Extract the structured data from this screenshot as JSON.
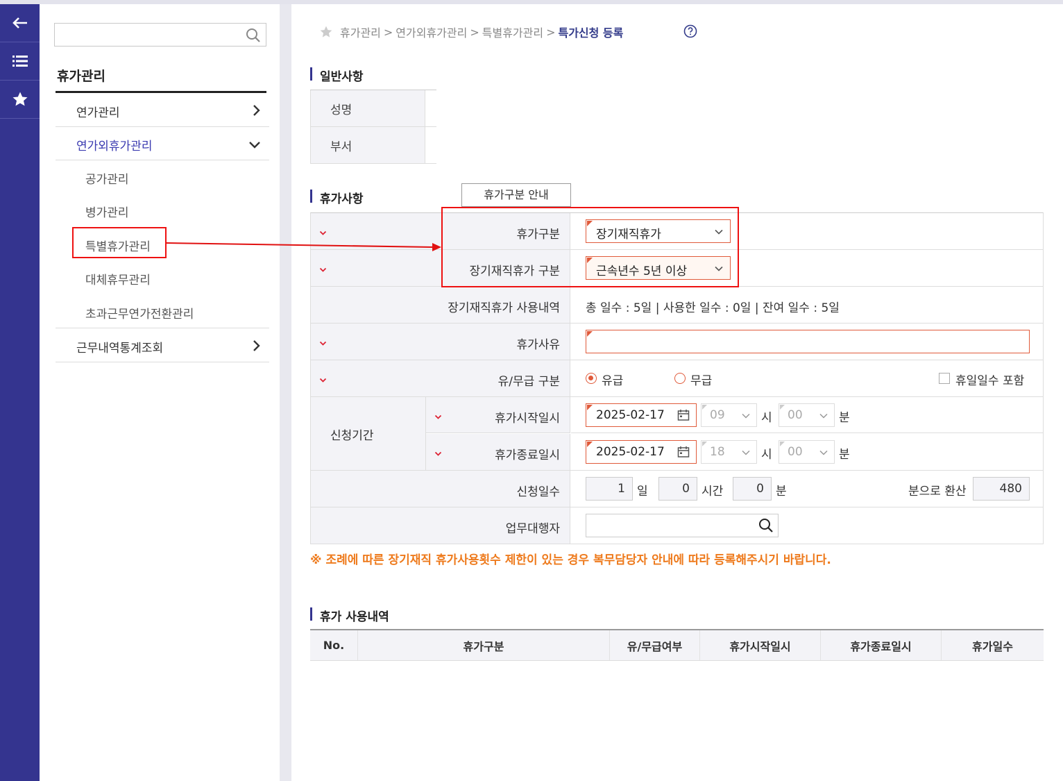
{
  "sidebar": {
    "search_placeholder": "",
    "menu_title": "휴가관리",
    "items": [
      {
        "label": "연가관리"
      },
      {
        "label": "연가외휴가관리"
      },
      {
        "label": "근무내역통계조회"
      }
    ],
    "sub_items": [
      {
        "label": "공가관리"
      },
      {
        "label": "병가관리"
      },
      {
        "label": "특별휴가관리"
      },
      {
        "label": "대체휴무관리"
      },
      {
        "label": "초과근무연가전환관리"
      }
    ]
  },
  "breadcrumb": {
    "items": [
      "휴가관리",
      "연가외휴가관리",
      "특별휴가관리"
    ],
    "separator": ">",
    "current": "특가신청 등록"
  },
  "general": {
    "title": "일반사항",
    "name_label": "성명",
    "dept_label": "부서"
  },
  "leave": {
    "title": "휴가사항",
    "guide_button": "휴가구분 안내",
    "type_label": "휴가구분",
    "type_value": "장기재직휴가",
    "subtype_label": "장기재직휴가 구분",
    "subtype_value": "근속년수 5년 이상",
    "history_label": "장기재직휴가 사용내역",
    "history_value": "총 일수 : 5일 | 사용한 일수 : 0일 | 잔여 일수 : 5일",
    "reason_label": "휴가사유",
    "reason_value": "",
    "pay_label": "유/무급 구분",
    "paid": "유급",
    "unpaid": "무급",
    "holiday_include": "휴일일수 포함",
    "period_label": "신청기간",
    "start_label": "휴가시작일시",
    "start_date": "2025-02-17",
    "start_hour": "09",
    "start_min": "00",
    "end_label": "휴가종료일시",
    "end_date": "2025-02-17",
    "end_hour": "18",
    "end_min": "00",
    "hour_unit": "시",
    "min_unit": "분",
    "days_label": "신청일수",
    "days_value": "1",
    "day_unit": "일",
    "hours_value": "0",
    "hours_unit": "시간",
    "mins_value": "0",
    "mins_unit": "분",
    "convert_label": "분으로 환산",
    "convert_value": "480",
    "proxy_label": "업무대행자",
    "proxy_value": ""
  },
  "notice": "※ 조례에 따른 장기재직 휴가사용횟수 제한이 있는 경우 복무담당자 안내에 따라 등록해주시기 바랍니다.",
  "usage": {
    "title": "휴가 사용내역",
    "columns": [
      "No.",
      "휴가구분",
      "유/무급여부",
      "휴가시작일시",
      "휴가종료일시",
      "휴가일수"
    ]
  },
  "colors": {
    "nav_bar": "#34348f",
    "required": "#e05a3a",
    "notice": "#ee7a1c",
    "annotation": "#e11111"
  }
}
